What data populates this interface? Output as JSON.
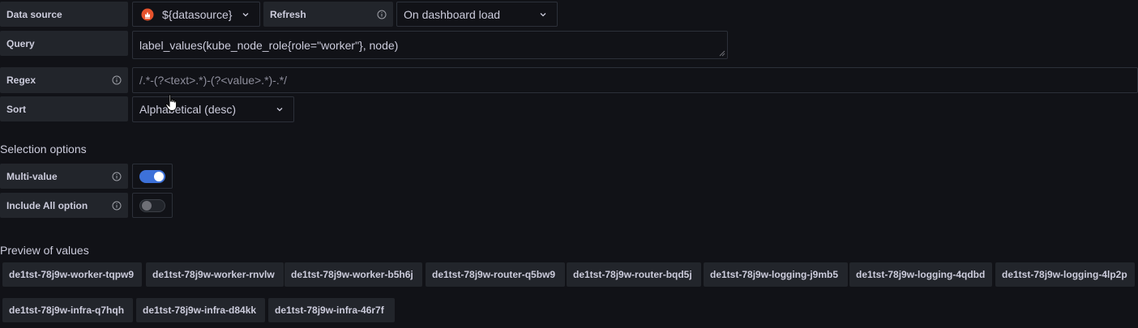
{
  "datasource": {
    "label": "Data source",
    "value": "${datasource}",
    "icon": "prometheus-logo-icon"
  },
  "refresh": {
    "label": "Refresh",
    "value": "On dashboard load"
  },
  "query": {
    "label": "Query",
    "value": "label_values(kube_node_role{role=\"worker\"}, node)"
  },
  "regex": {
    "label": "Regex",
    "value": "/.*-(?<text>.*)-(?<value>.*)-.*/"
  },
  "sort": {
    "label": "Sort",
    "value": "Alphabetical (desc)"
  },
  "selection": {
    "title": "Selection options",
    "multi_value": {
      "label": "Multi-value",
      "enabled": true
    },
    "include_all": {
      "label": "Include All option",
      "enabled": false
    }
  },
  "preview": {
    "title": "Preview of values",
    "values": [
      "de1tst-78j9w-worker-tqpw9",
      "de1tst-78j9w-worker-rnvlw",
      "de1tst-78j9w-worker-b5h6j",
      "de1tst-78j9w-router-q5bw9",
      "de1tst-78j9w-router-bqd5j",
      "de1tst-78j9w-logging-j9mb5",
      "de1tst-78j9w-logging-4qdbd",
      "de1tst-78j9w-logging-4lp2p",
      "de1tst-78j9w-infra-q7hqh",
      "de1tst-78j9w-infra-d84kk",
      "de1tst-78j9w-infra-46r7f"
    ]
  },
  "colors": {
    "background": "#111217",
    "label_bg": "#22252b",
    "border": "#2c3039",
    "accent": "#3d71d9",
    "prometheus": "#e6522c"
  }
}
